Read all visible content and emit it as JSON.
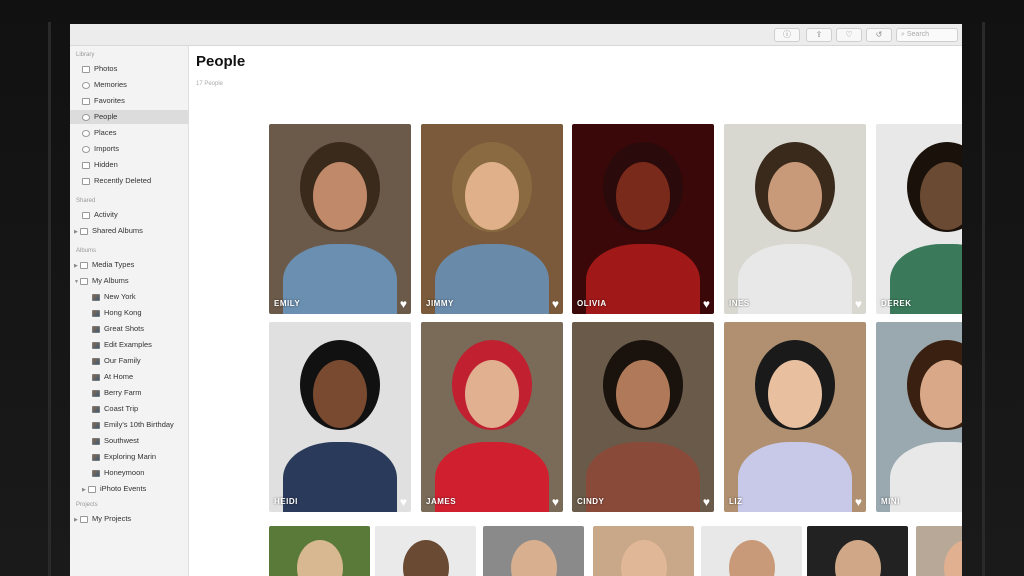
{
  "toolbar": {
    "search_placeholder": "Search",
    "icons": [
      "info-icon",
      "share-icon",
      "favorite-icon",
      "rotate-icon"
    ]
  },
  "sidebar": {
    "library_header": "Library",
    "library": [
      "Photos",
      "Memories",
      "Favorites",
      "People",
      "Places",
      "Imports",
      "Hidden",
      "Recently Deleted"
    ],
    "shared_header": "Shared",
    "shared": [
      "Activity",
      "Shared Albums"
    ],
    "albums_header": "Albums",
    "albums_top": [
      "Media Types",
      "My Albums"
    ],
    "my_albums": [
      "New York",
      "Hong Kong",
      "Great Shots",
      "Edit Examples",
      "Our Family",
      "At Home",
      "Berry Farm",
      "Coast Trip",
      "Emily's 10th Birthday",
      "Southwest",
      "Exploring Marin",
      "Honeymoon"
    ],
    "iphoto_events": "iPhoto Events",
    "projects_header": "Projects",
    "projects": [
      "My Projects"
    ]
  },
  "main": {
    "title": "People",
    "count": "17 People",
    "row1": [
      "EMILY",
      "JIMMY",
      "OLIVIA",
      "INES",
      "DEREK"
    ],
    "row2": [
      "HEIDI",
      "JAMES",
      "CINDY",
      "LIZ",
      "MINI"
    ]
  }
}
